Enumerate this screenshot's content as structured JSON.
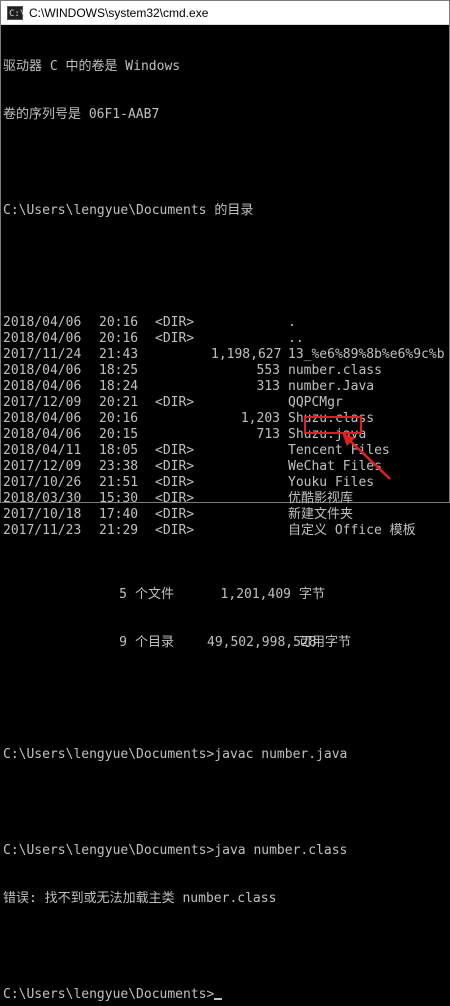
{
  "window": {
    "title": "C:\\WINDOWS\\system32\\cmd.exe",
    "icon": "console-icon",
    "icon_glyph": "C:\\"
  },
  "header_lines": [
    "驱动器 C 中的卷是 Windows",
    "卷的序列号是 06F1-AAB7"
  ],
  "dir_title": "C:\\Users\\lengyue\\Documents 的目录",
  "entries": [
    {
      "date": "2018/04/06",
      "time": "20:16",
      "type": "<DIR>",
      "size": "",
      "name": "."
    },
    {
      "date": "2018/04/06",
      "time": "20:16",
      "type": "<DIR>",
      "size": "",
      "name": ".."
    },
    {
      "date": "2017/11/24",
      "time": "21:43",
      "type": "",
      "size": "1,198,627",
      "name": "13_%e6%89%8b%e6%9c%b"
    },
    {
      "date": "2018/04/06",
      "time": "18:25",
      "type": "",
      "size": "553",
      "name": "number.class"
    },
    {
      "date": "2018/04/06",
      "time": "18:24",
      "type": "",
      "size": "313",
      "name": "number.Java"
    },
    {
      "date": "2017/12/09",
      "time": "20:21",
      "type": "<DIR>",
      "size": "",
      "name": "QQPCMgr"
    },
    {
      "date": "2018/04/06",
      "time": "20:16",
      "type": "",
      "size": "1,203",
      "name": "Shuzu.class"
    },
    {
      "date": "2018/04/06",
      "time": "20:15",
      "type": "",
      "size": "713",
      "name": "Shuzu.java"
    },
    {
      "date": "2018/04/11",
      "time": "18:05",
      "type": "<DIR>",
      "size": "",
      "name": "Tencent Files"
    },
    {
      "date": "2017/12/09",
      "time": "23:38",
      "type": "<DIR>",
      "size": "",
      "name": "WeChat Files"
    },
    {
      "date": "2017/10/26",
      "time": "21:51",
      "type": "<DIR>",
      "size": "",
      "name": "Youku Files"
    },
    {
      "date": "2018/03/30",
      "time": "15:30",
      "type": "<DIR>",
      "size": "",
      "name": "优酷影视库"
    },
    {
      "date": "2017/10/18",
      "time": "17:40",
      "type": "<DIR>",
      "size": "",
      "name": "新建文件夹"
    },
    {
      "date": "2017/11/23",
      "time": "21:29",
      "type": "<DIR>",
      "size": "",
      "name": "自定义 Office 模板"
    }
  ],
  "summary": [
    {
      "count": "5",
      "unit": "个文件",
      "size": "1,201,409",
      "suffix": "字节"
    },
    {
      "count": "9",
      "unit": "个目录",
      "size": "49,502,998,528",
      "suffix": "可用字节"
    }
  ],
  "commands": [
    "C:\\Users\\lengyue\\Documents>javac number.java",
    "C:\\Users\\lengyue\\Documents>java number.class"
  ],
  "error_line": "错误: 找不到或无法加载主类 number.class",
  "final_prompt": "C:\\Users\\lengyue\\Documents>",
  "annotation": {
    "color": "#e02020",
    "highlighted_text": ".class"
  }
}
